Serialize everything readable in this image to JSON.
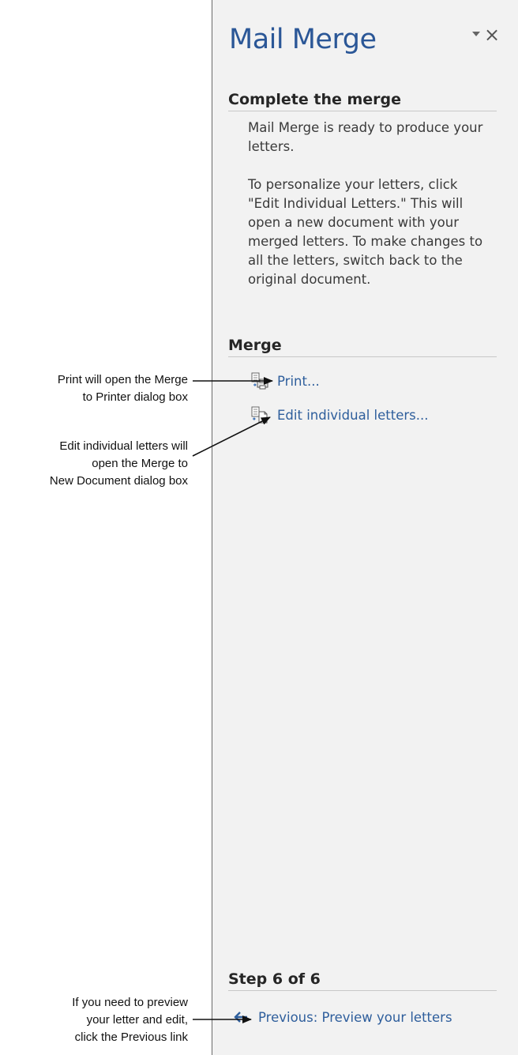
{
  "pane": {
    "title": "Mail Merge",
    "dropdown_icon": "chevron-down-icon",
    "close_icon": "close-icon",
    "close_glyph": "×",
    "section_complete": {
      "heading": "Complete the merge",
      "paragraph1": "Mail Merge is ready to produce your letters.",
      "paragraph2": "To personalize your letters, click \"Edit Individual Letters.\" This will open a new document with your merged letters. To make changes to all the letters, switch back to the original document."
    },
    "section_merge": {
      "heading": "Merge",
      "print_label": "Print...",
      "print_icon": "print-merge-icon",
      "edit_label": "Edit individual letters...",
      "edit_icon": "edit-letters-icon"
    },
    "step": {
      "heading": "Step 6 of 6",
      "previous_label": "Previous: Preview your letters",
      "previous_icon": "arrow-left-icon"
    }
  },
  "callouts": {
    "print": [
      "Print will open the Merge",
      "to Printer dialog box"
    ],
    "edit": [
      "Edit individual letters will",
      "open the Merge to",
      "New Document dialog box"
    ],
    "previous": [
      "If you need to preview",
      "your letter and edit,",
      "click the Previous link"
    ]
  },
  "colors": {
    "title": "#2b5797",
    "link": "#2e5e9c",
    "pane_background": "#f2f2f2"
  }
}
